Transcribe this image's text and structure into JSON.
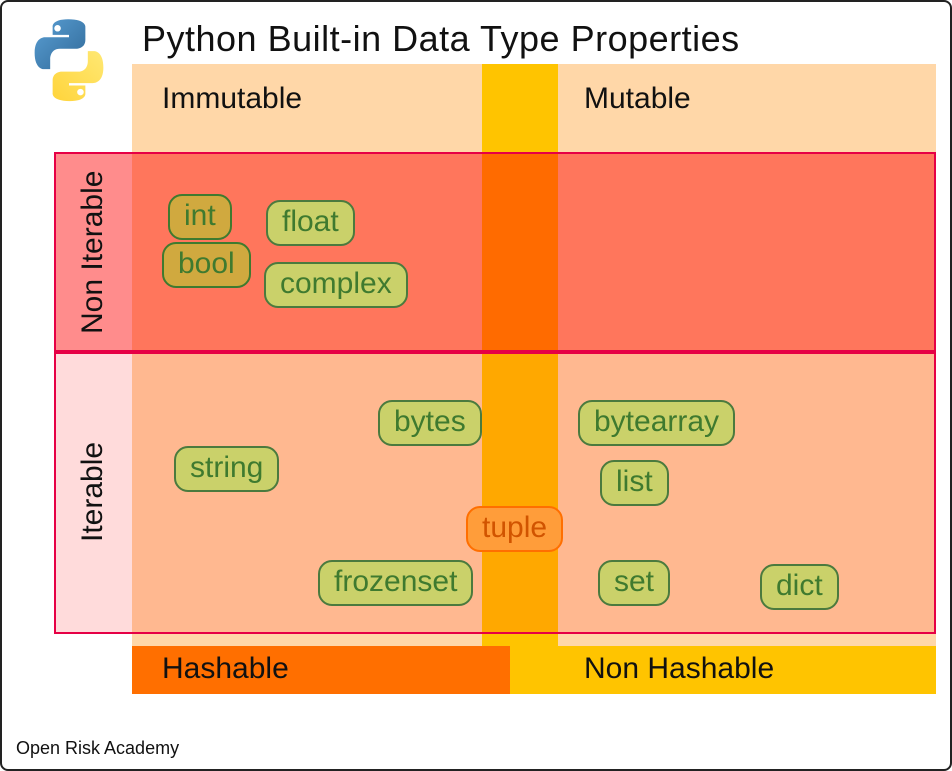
{
  "title": "Python Built-in Data Type Properties",
  "footer": "Open Risk Academy",
  "columns": {
    "immutable": "Immutable",
    "mutable": "Mutable",
    "hashable": "Hashable",
    "non_hashable": "Non Hashable"
  },
  "rows": {
    "non_iterable": "Non Iterable",
    "iterable": "Iterable"
  },
  "types": {
    "int": "int",
    "bool": "bool",
    "float": "float",
    "complex": "complex",
    "string": "string",
    "bytes": "bytes",
    "frozenset": "frozenset",
    "tuple": "tuple",
    "bytearray": "bytearray",
    "list": "list",
    "set": "set",
    "dict": "dict"
  },
  "logo_name": "python-logo-icon"
}
